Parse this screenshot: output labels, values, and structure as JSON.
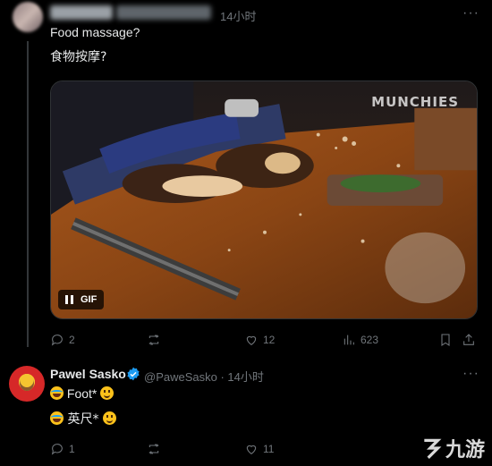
{
  "top_tweet": {
    "time": "14小时",
    "more": "···",
    "line1": "Food massage?",
    "line2": "食物按摩?",
    "media": {
      "watermark": "MUNCHIES",
      "badge": "GIF"
    },
    "stats": {
      "replies": "2",
      "retweets": "",
      "likes": "12",
      "views": "623"
    }
  },
  "reply": {
    "name": "Pawel Sasko",
    "handle": "@PaweSasko · 14小时",
    "more": "···",
    "line1_text": "Foot* ",
    "line2_text": "英尺* ",
    "stats": {
      "replies": "1",
      "retweets": "",
      "likes": "11"
    }
  },
  "site_watermark": "九游",
  "icons": [
    "pause-icon",
    "reply-icon",
    "retweet-icon",
    "like-icon",
    "views-icon",
    "bookmark-icon",
    "share-icon",
    "verified-icon",
    "face-with-tears-of-joy-icon",
    "slightly-smiling-face-icon"
  ],
  "colors": {
    "background": "#000000",
    "text": "#e7e9ea",
    "muted": "#71767b",
    "verified": "#1d9bf0"
  }
}
